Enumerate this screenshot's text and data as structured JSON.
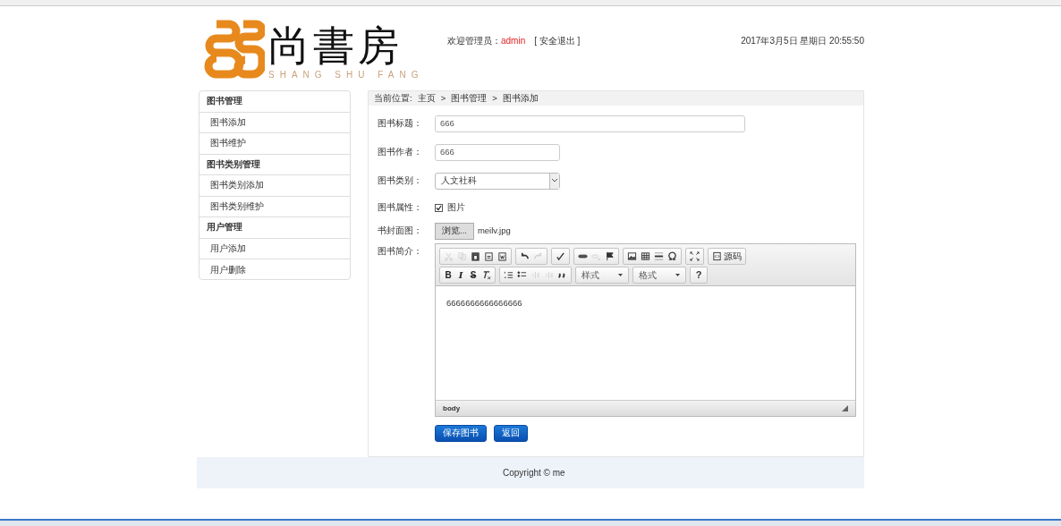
{
  "header": {
    "logo_title": "尚書房",
    "logo_subtitle": "SHANG SHU FANG",
    "welcome_label": "欢迎管理员：",
    "username": "admin",
    "logout": "[ 安全退出 ]",
    "datetime": "2017年3月5日 星期日 20:55:50"
  },
  "sidebar": [
    {
      "title": "图书管理",
      "items": [
        {
          "label": "图书添加"
        },
        {
          "label": "图书维护"
        }
      ]
    },
    {
      "title": "图书类别管理",
      "items": [
        {
          "label": "图书类别添加"
        },
        {
          "label": "图书类别维护"
        }
      ]
    },
    {
      "title": "用户管理",
      "items": [
        {
          "label": "用户添加"
        },
        {
          "label": "用户删除"
        }
      ]
    }
  ],
  "breadcrumb": {
    "label": "当前位置:",
    "items": [
      "主页",
      "图书管理",
      "图书添加"
    ],
    "separator": ">"
  },
  "form": {
    "title": {
      "label": "图书标题：",
      "value": "666"
    },
    "author": {
      "label": "图书作者：",
      "value": "666"
    },
    "category": {
      "label": "图书类别：",
      "value": "人文社科"
    },
    "attribute": {
      "label": "图书属性：",
      "option": "图片",
      "checked": true
    },
    "cover": {
      "label": "书封面图：",
      "button": "浏览...",
      "filename": "meilv.jpg"
    },
    "intro": {
      "label": "图书简介："
    }
  },
  "editor": {
    "toolbar_rows": [
      [
        [
          {
            "kind": "cut",
            "disabled": true
          },
          {
            "kind": "copy",
            "disabled": true
          },
          {
            "kind": "paste",
            "disabled": false
          },
          {
            "kind": "paste-text",
            "disabled": false
          },
          {
            "kind": "paste-word",
            "disabled": false
          }
        ],
        [
          {
            "kind": "undo",
            "disabled": false
          },
          {
            "kind": "redo",
            "disabled": true
          }
        ],
        [
          {
            "kind": "spellcheck",
            "disabled": false
          }
        ],
        [
          {
            "kind": "link",
            "disabled": false
          },
          {
            "kind": "unlink",
            "disabled": true
          },
          {
            "kind": "anchor",
            "disabled": false
          }
        ],
        [
          {
            "kind": "image",
            "disabled": false
          },
          {
            "kind": "table",
            "disabled": false
          },
          {
            "kind": "rule",
            "disabled": false
          },
          {
            "kind": "omega",
            "disabled": false
          }
        ],
        [
          {
            "kind": "maximize",
            "disabled": false
          }
        ],
        [
          {
            "kind": "source",
            "disabled": false,
            "label": "源码"
          }
        ]
      ],
      [
        [
          {
            "kind": "bold",
            "label": "B"
          },
          {
            "kind": "italic",
            "label": "I"
          },
          {
            "kind": "strike",
            "label": "S"
          },
          {
            "kind": "clear-format",
            "disabled": false
          }
        ],
        [
          {
            "kind": "numbered-list",
            "disabled": false
          },
          {
            "kind": "bullet-list",
            "disabled": false
          },
          {
            "kind": "outdent",
            "disabled": true
          },
          {
            "kind": "indent",
            "disabled": true
          },
          {
            "kind": "quote",
            "disabled": false
          }
        ],
        [
          {
            "kind": "dropdown",
            "label": "样式"
          }
        ],
        [
          {
            "kind": "dropdown",
            "label": "格式"
          }
        ],
        [
          {
            "kind": "help",
            "label": "?"
          }
        ]
      ]
    ],
    "content": "6666666666666666",
    "status_path": "body"
  },
  "buttons": [
    "保存图书",
    "返回"
  ],
  "footer": "Copyright © me"
}
